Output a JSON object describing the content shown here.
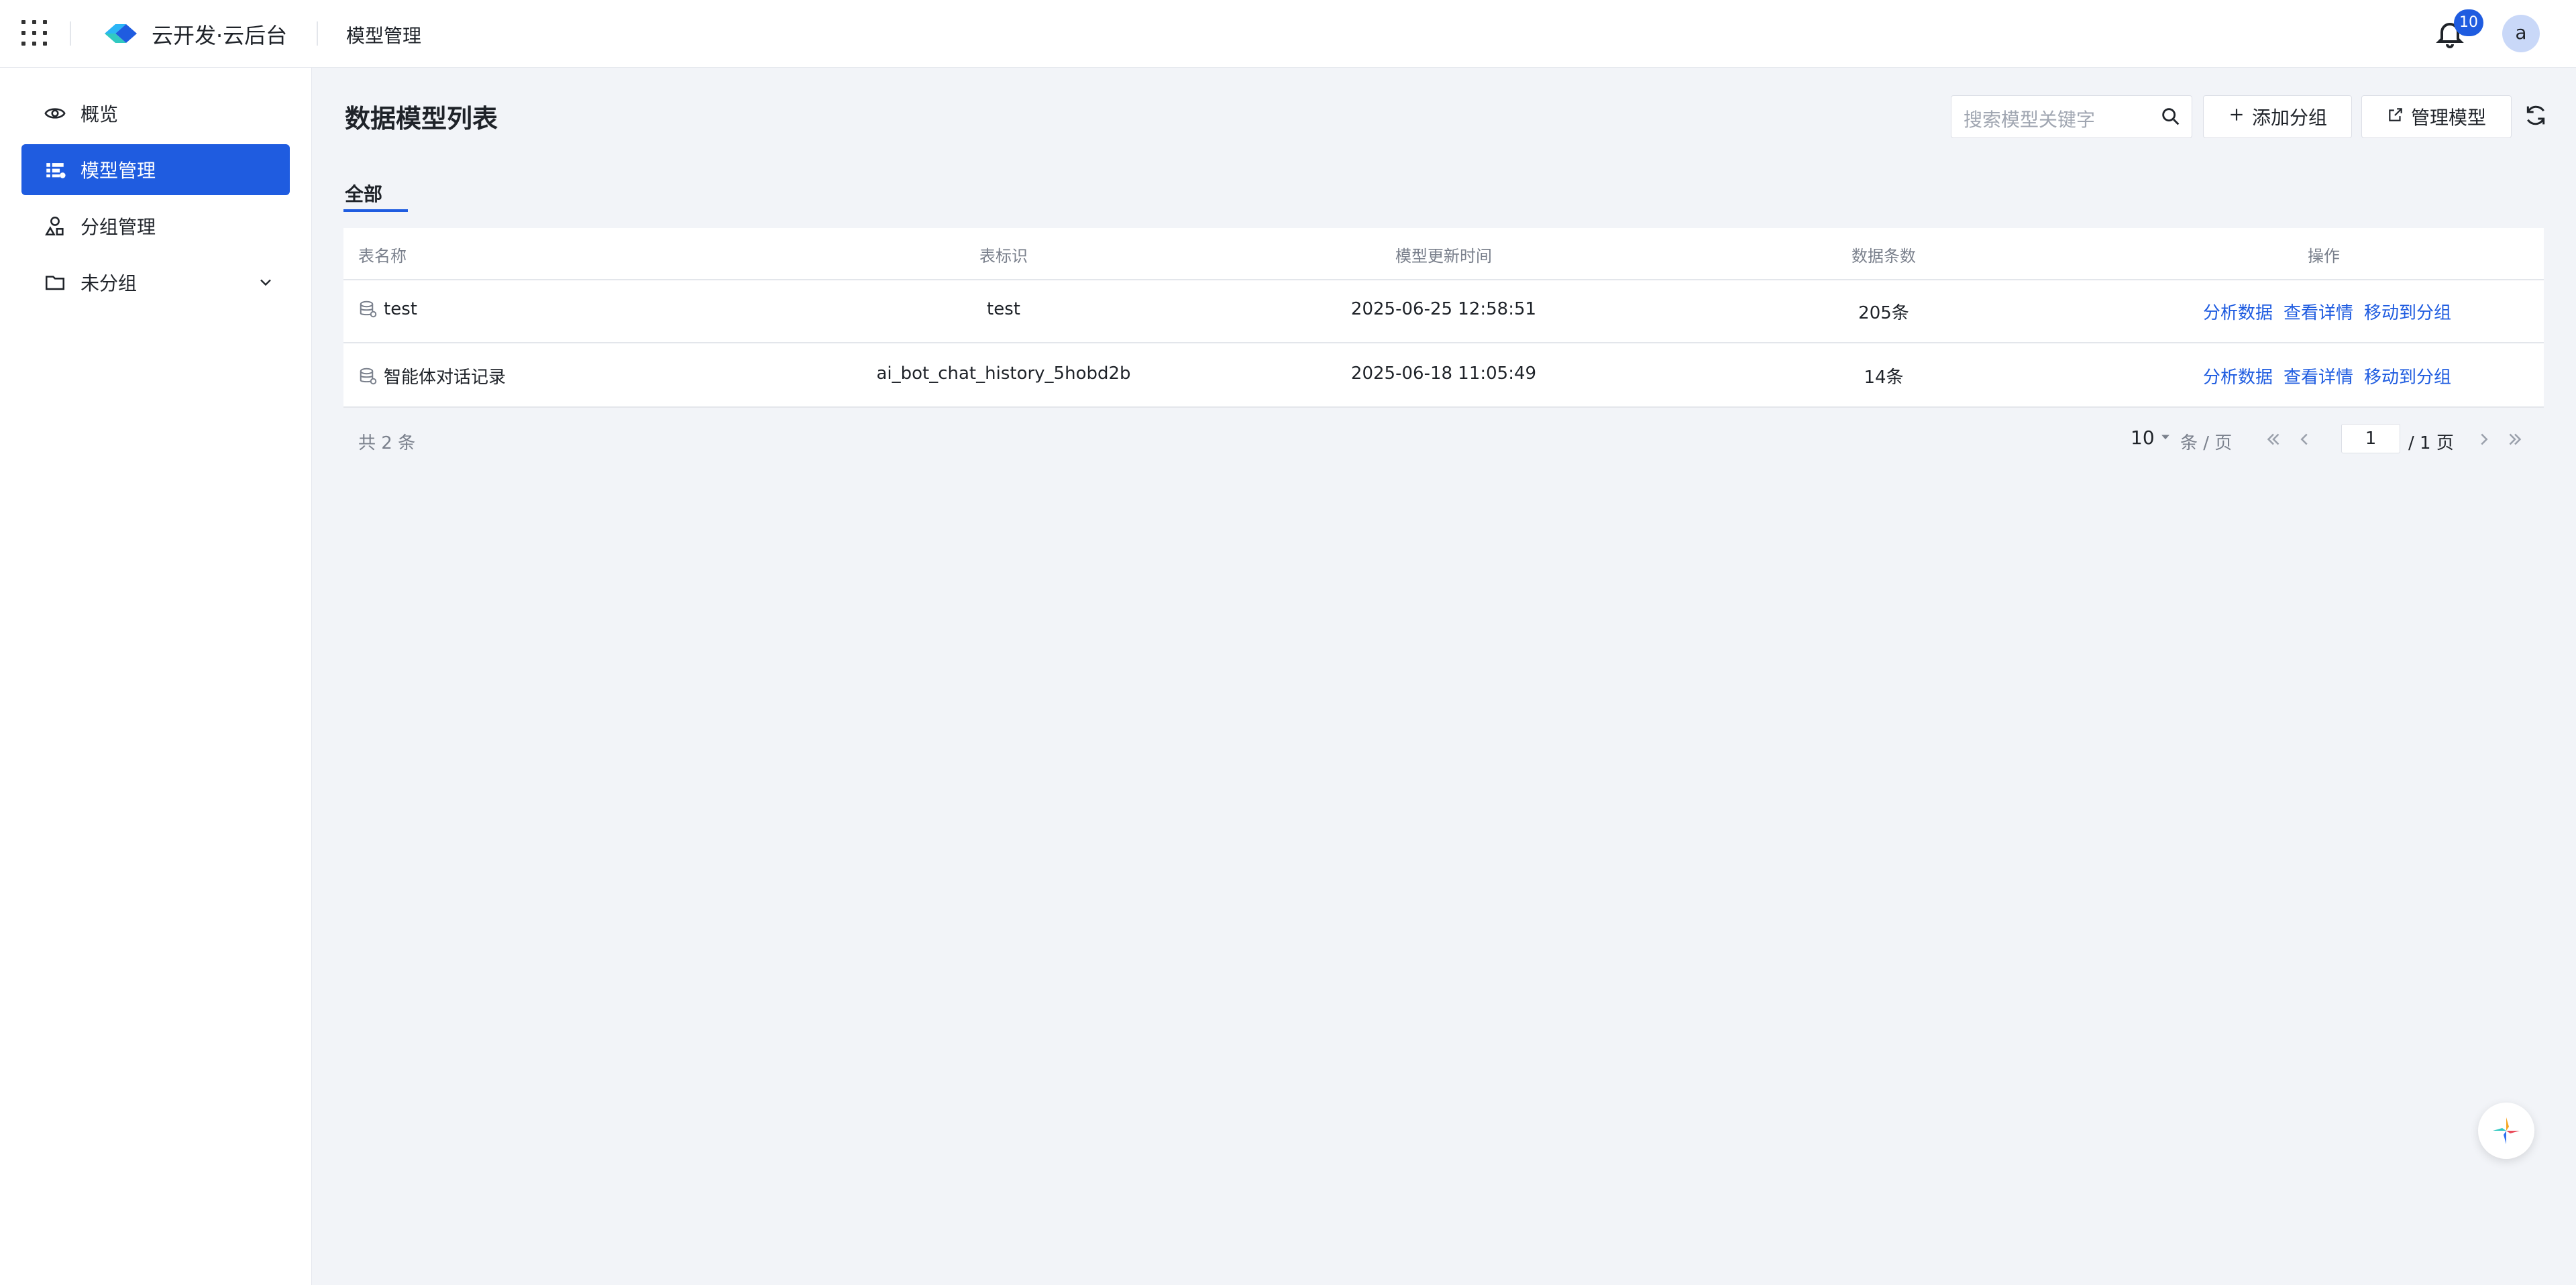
{
  "header": {
    "brand": "云开发·云后台",
    "breadcrumb": "模型管理",
    "notification_count": "10",
    "avatar_letter": "a"
  },
  "sidebar": {
    "items": [
      {
        "label": "概览",
        "icon": "eye-icon",
        "active": false
      },
      {
        "label": "模型管理",
        "icon": "model-manage-icon",
        "active": true
      },
      {
        "label": "分组管理",
        "icon": "group-shapes-icon",
        "active": false
      },
      {
        "label": "未分组",
        "icon": "folder-icon",
        "active": false
      }
    ]
  },
  "main": {
    "title": "数据模型列表",
    "search_placeholder": "搜索模型关键字",
    "add_group_label": "添加分组",
    "manage_model_label": "管理模型",
    "tabs": [
      {
        "label": "全部"
      }
    ]
  },
  "table": {
    "columns": [
      "表名称",
      "表标识",
      "模型更新时间",
      "数据条数",
      "操作"
    ],
    "rows": [
      {
        "name": "test",
        "id": "test",
        "updated": "2025-06-25 12:58:51",
        "count": "205条"
      },
      {
        "name": "智能体对话记录",
        "id": "ai_bot_chat_history_5hobd2b",
        "updated": "2025-06-18 11:05:49",
        "count": "14条"
      }
    ],
    "actions": [
      "分析数据",
      "查看详情",
      "移动到分组"
    ]
  },
  "pagination": {
    "total_text": "共 2 条",
    "page_size": "10",
    "per_page_text": "条 / 页",
    "current_page": "1",
    "total_pages_text": "/ 1 页"
  },
  "colors": {
    "accent": "#1f5ce0",
    "background": "#f2f4f8"
  }
}
